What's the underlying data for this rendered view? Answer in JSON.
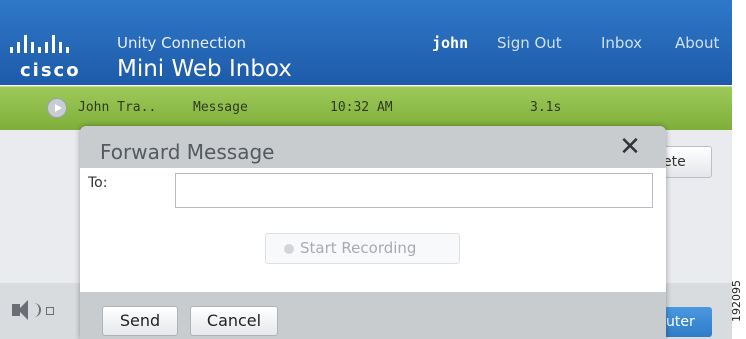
{
  "header": {
    "logo_text": "cisco",
    "app_subtitle": "Unity Connection",
    "app_title": "Mini Web Inbox",
    "user": "john",
    "nav": [
      "Sign Out",
      "Inbox",
      "About"
    ]
  },
  "message_row": {
    "sender": "John Tra..",
    "type": "Message",
    "time": "10:32 AM",
    "duration": "3.1s"
  },
  "background": {
    "button_partial": "ete",
    "blue_button_partial": "uter"
  },
  "dialog": {
    "title": "Forward Message",
    "close_symbol": "✕",
    "to_label": "To:",
    "to_value": "",
    "record_label": "Start Recording",
    "send_label": "Send",
    "cancel_label": "Cancel"
  },
  "watermark": "192095",
  "colors": {
    "header_blue": "#2f78c8",
    "row_green": "#8fbd4a",
    "dialog_gray": "#c9cccf",
    "accent_blue": "#3a88d4"
  }
}
